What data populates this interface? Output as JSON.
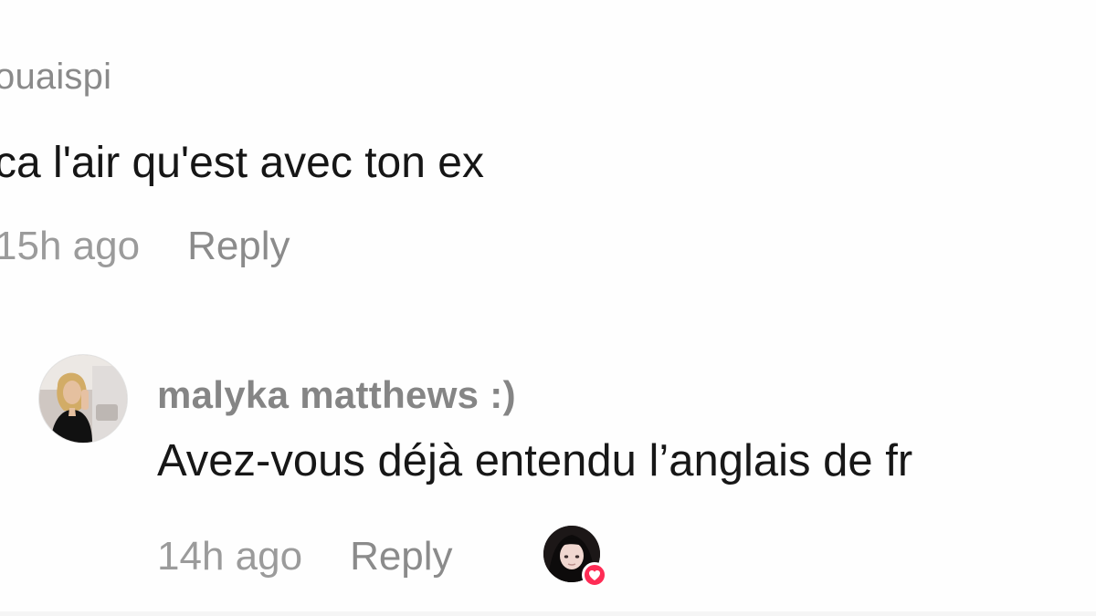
{
  "comments": [
    {
      "username": "ouaispi",
      "text": "ca l'air qu'est avec ton ex",
      "time": "15h ago",
      "reply_label": "Reply"
    }
  ],
  "reply": {
    "username": "malyka matthews :)",
    "text": "Avez-vous déjà entendu l’anglais de fr",
    "time": "14h ago",
    "reply_label": "Reply",
    "avatar_icon": "profile-photo",
    "liked_by_creator": true,
    "creator_avatar_icon": "profile-photo",
    "heart_icon": "heart-icon",
    "heart_color": "#fe2c55"
  }
}
